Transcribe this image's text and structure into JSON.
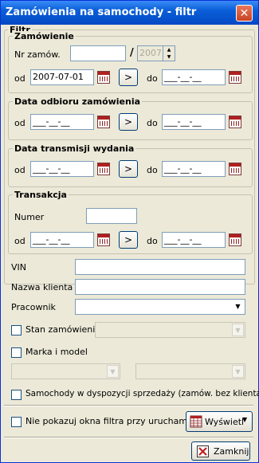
{
  "window": {
    "title": "Zamówienia na samochody - filtr",
    "close_label": "✕"
  },
  "filtr_label": "Filtr",
  "zamowienie": {
    "title": "Zamówienie",
    "nr_label": "Nr zamów.",
    "nr_value": "",
    "slash": "/",
    "year_value": "2007",
    "od_label": "od",
    "od_value": "2007-07-01",
    "do_label": "do",
    "do_value": "___-__-__"
  },
  "data_odbioru": {
    "title": "Data odbioru zamówienia",
    "od_label": "od",
    "od_value": "___-__-__",
    "do_label": "do",
    "do_value": "___-__-__"
  },
  "data_transmisji": {
    "title": "Data transmisji wydania",
    "od_label": "od",
    "od_value": "___-__-__",
    "do_label": "do",
    "do_value": "___-__-__"
  },
  "transakcja": {
    "title": "Transakcja",
    "numer_label": "Numer",
    "numer_value": "",
    "od_label": "od",
    "od_value": "___-__-__",
    "do_label": "do",
    "do_value": "___-__-__"
  },
  "arrow_label": ">",
  "vin_label": "VIN",
  "klient_label": "Nazwa klienta",
  "pracownik_label": "Pracownik",
  "stan_label": "Stan zamówienia",
  "marka_label": "Marka i model",
  "dyspozycja_label": "Samochody w dyspozycji sprzedaży (zamów. bez klienta)",
  "nie_pokazuj_label": "Nie pokazuj okna filtra przy uruchamianiu",
  "wyswietl_label": "Wyświetl",
  "zamknij_label": "Zamknij",
  "colors": {
    "title_bar": "#0a5fd8",
    "window_bg": "#ece9d8",
    "close_red": "#c84324"
  }
}
